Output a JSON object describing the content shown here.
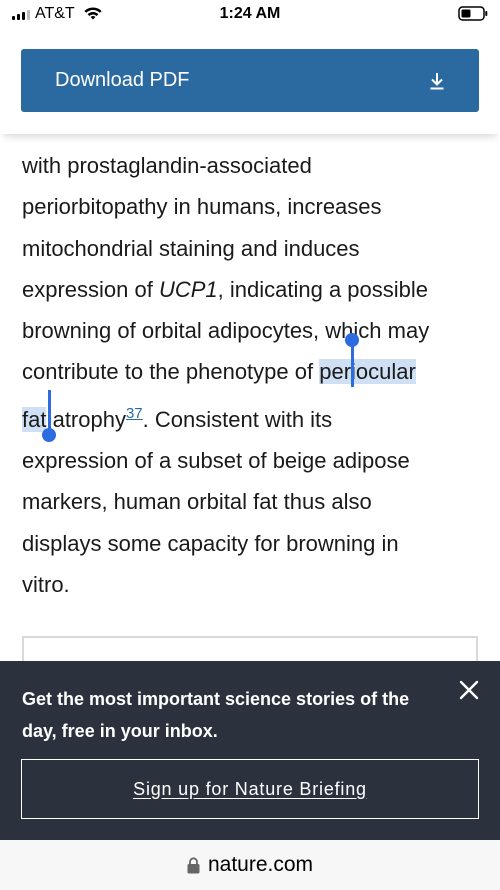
{
  "status_bar": {
    "carrier": "AT&T",
    "time": "1:24 AM",
    "icons": [
      "signal-icon",
      "wifi-icon",
      "battery-icon"
    ]
  },
  "download": {
    "label": "Download PDF",
    "icon": "download-icon"
  },
  "article": {
    "lines": {
      "l1": "with prostaglandin-associated",
      "l2": "periorbitopathy in humans, increases",
      "l3": "mitochondrial staining and induces",
      "l4a": "expression of ",
      "l4b": "UCP1",
      "l4c": ", indicating a possible",
      "l5": "browning of orbital adipocytes, which may",
      "l6a": "contribute to the phenotype of ",
      "l6b": "periocular",
      "l7a": "fat",
      "l7b": " atrophy",
      "l7ref": "37",
      "l7c": ". Consistent with its",
      "l8": "expression of a subset of beige adipose",
      "l9": "markers, human orbital fat thus also",
      "l10": "displays some capacity for browning in",
      "l11": "vitro."
    },
    "selected_text": "periocular fat"
  },
  "newsletter": {
    "text": "Get the most important science stories of the day, free in your inbox.",
    "signup_label": "Sign up for Nature Briefing",
    "close_icon": "close-icon"
  },
  "address_bar": {
    "domain": "nature.com",
    "icon": "lock-icon"
  },
  "colors": {
    "accent": "#2a6aa0",
    "banner_bg": "#2b323d",
    "selection": "#cfe0f5",
    "selection_handle": "#2d6be0"
  }
}
